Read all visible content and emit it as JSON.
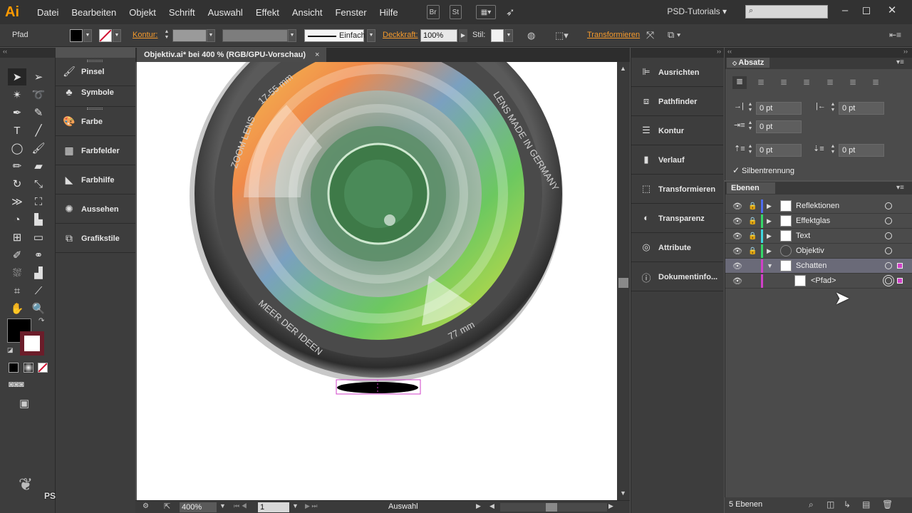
{
  "app": {
    "logo": "Ai",
    "workspace": "PSD-Tutorials"
  },
  "menu": [
    "Datei",
    "Bearbeiten",
    "Objekt",
    "Schrift",
    "Auswahl",
    "Effekt",
    "Ansicht",
    "Fenster",
    "Hilfe"
  ],
  "menubar_buttons": {
    "bridge": "Br",
    "stock": "St"
  },
  "window_controls": {
    "minimize": "‒",
    "maximize": "◻",
    "close": "✕"
  },
  "control_bar": {
    "selection_type": "Pfad",
    "kontur_label": "Kontur:",
    "stroke_style": "Einfach",
    "deckkraft_label": "Deckkraft:",
    "deckkraft_value": "100%",
    "stil_label": "Stil:",
    "transformieren_label": "Transformieren"
  },
  "left_dock": [
    {
      "icon": "brush-icon",
      "label": "Pinsel"
    },
    {
      "icon": "symbols-icon",
      "label": "Symbole"
    },
    {
      "icon": "palette-icon",
      "label": "Farbe"
    },
    {
      "icon": "swatches-icon",
      "label": "Farbfelder"
    },
    {
      "icon": "color-guide-icon",
      "label": "Farbhilfe"
    },
    {
      "icon": "appearance-icon",
      "label": "Aussehen"
    },
    {
      "icon": "graphic-styles-icon",
      "label": "Grafikstile"
    }
  ],
  "document": {
    "tab_title": "Objektiv.ai* bei 400 % (RGB/GPU-Vorschau)",
    "lens_text_top": "ZOOM LENS",
    "lens_text_focal": "17-55 mm",
    "lens_text_right": "LENS MADE IN GERMANY",
    "lens_text_bottom": "MEER DER IDEEN",
    "lens_text_diameter": "77 mm"
  },
  "status_bar": {
    "zoom": "400%",
    "artboard": "1",
    "mode": "Auswahl"
  },
  "mid_dock": [
    {
      "icon": "align-icon",
      "label": "Ausrichten"
    },
    {
      "icon": "pathfinder-icon",
      "label": "Pathfinder"
    },
    {
      "icon": "stroke-icon",
      "label": "Kontur"
    },
    {
      "icon": "gradient-icon",
      "label": "Verlauf"
    },
    {
      "icon": "transform-icon",
      "label": "Transformieren"
    },
    {
      "icon": "transparency-icon",
      "label": "Transparenz"
    },
    {
      "icon": "attributes-icon",
      "label": "Attribute"
    },
    {
      "icon": "document-info-icon",
      "label": "Dokumentinfo..."
    }
  ],
  "absatz": {
    "title": "Absatz",
    "left_indent": "0 pt",
    "right_indent": "0 pt",
    "first_line_indent": "0 pt",
    "space_before": "0 pt",
    "space_after": "0 pt",
    "hyphenation_label": "Silbentrennung"
  },
  "ebenen": {
    "title": "Ebenen",
    "layers": [
      {
        "name": "Reflektionen",
        "color": "#4f6cf0",
        "expanded": false,
        "locked": true
      },
      {
        "name": "Effektglas",
        "color": "#35d86a",
        "expanded": false,
        "locked": true
      },
      {
        "name": "Text",
        "color": "#3fd8e0",
        "expanded": false,
        "locked": true
      },
      {
        "name": "Objektiv",
        "color": "#35d86a",
        "expanded": false,
        "locked": true
      },
      {
        "name": "Schatten",
        "color": "#d040c8",
        "expanded": true,
        "locked": false
      },
      {
        "name": "<Pfad>",
        "color": "#d040c8",
        "expanded": false,
        "locked": false
      }
    ],
    "footer_count": "5 Ebenen"
  }
}
